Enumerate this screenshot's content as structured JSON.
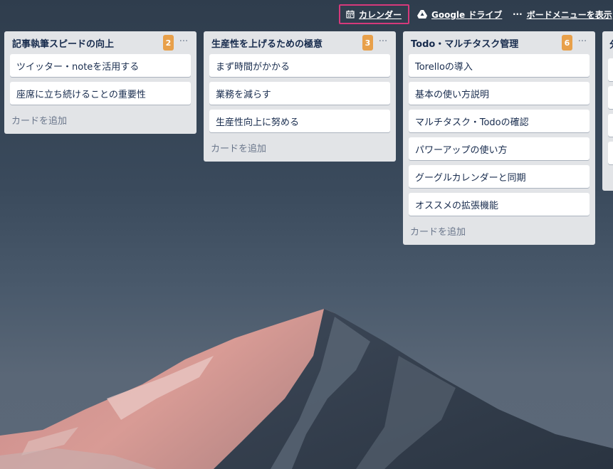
{
  "header": {
    "calendar_label": "カレンダー",
    "gdrive_label": "Google ドライブ",
    "menu_label": "ボードメニューを表示"
  },
  "lists": [
    {
      "title": "記事執筆スピードの向上",
      "count": "2",
      "more": "···",
      "cards": [
        "ツイッター・noteを活用する",
        "座席に立ち続けることの重要性"
      ],
      "add_card": "カードを追加"
    },
    {
      "title": "生産性を上げるための極意",
      "count": "3",
      "more": "···",
      "cards": [
        "まず時間がかかる",
        "業務を減らす",
        "生産性向上に努める"
      ],
      "add_card": "カードを追加"
    },
    {
      "title": "Todo・マルチタスク管理",
      "count": "6",
      "more": "···",
      "cards": [
        "Torelloの導入",
        "基本の使い方説明",
        "マルチタスク・Todoの確認",
        "パワーアップの使い方",
        "グーグルカレンダーと同期",
        "オススメの拡張機能"
      ],
      "add_card": "カードを追加"
    }
  ],
  "partial_list": {
    "title_fragment": "分"
  },
  "colors": {
    "calendar_highlight": "#d6397b",
    "count_badge": "#e8a04a",
    "list_bg": "#e2e4e7",
    "card_bg": "#ffffff"
  }
}
